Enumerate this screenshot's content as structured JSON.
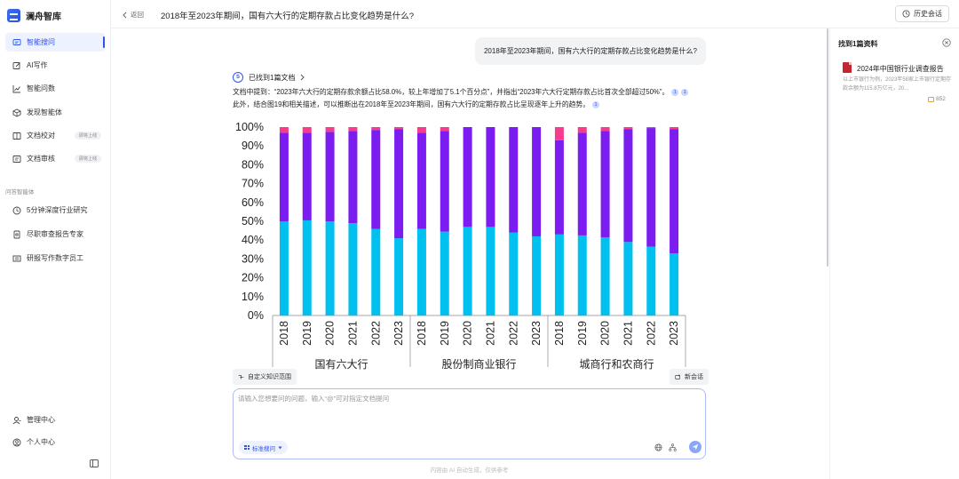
{
  "app": {
    "brand": "澜舟智库"
  },
  "sidebar": {
    "items": [
      {
        "label": "智能搜问",
        "icon": "chat-icon",
        "active": true,
        "badge": ""
      },
      {
        "label": "AI写作",
        "icon": "edit-icon",
        "active": false,
        "badge": ""
      },
      {
        "label": "智能问数",
        "icon": "chart-line-icon",
        "active": false,
        "badge": ""
      },
      {
        "label": "发现智能体",
        "icon": "cube-icon",
        "active": false,
        "badge": ""
      },
      {
        "label": "文档校对",
        "icon": "doc-check-icon",
        "active": false,
        "badge": "即将上线"
      },
      {
        "label": "文档审核",
        "icon": "doc-review-icon",
        "active": false,
        "badge": "即将上线"
      }
    ],
    "section_label": "问答智能体",
    "agents": [
      {
        "label": "5分钟深度行业研究",
        "icon": "clock-icon"
      },
      {
        "label": "尽职审查报告专家",
        "icon": "report-icon"
      },
      {
        "label": "研报写作数字员工",
        "icon": "book-icon"
      }
    ],
    "bottom": [
      {
        "label": "管理中心",
        "icon": "admin-icon"
      },
      {
        "label": "个人中心",
        "icon": "user-icon"
      }
    ]
  },
  "topbar": {
    "back_label": "返回",
    "title": "2018年至2023年期间，国有六大行的定期存款占比变化趋势是什么?",
    "history_label": "历史会话"
  },
  "chat": {
    "user_question": "2018年至2023年期间，国有六大行的定期存款占比变化趋势是什么?",
    "found_label": "已找到1篇文档",
    "answer_line1": "文档中提到：“2023年六大行的定期存款余额占比58.0%，较上年增加了5.1个百分点”，并指出“2023年六大行定期存款占比首次全部超过50%”。",
    "answer_line2": "此外，结合图19和相关描述，可以推断出在2018年至2023年期间，国有六大行的定期存款占比呈现逐年上升的趋势。",
    "cite_num": "1"
  },
  "chart_data": {
    "type": "bar",
    "stacked": true,
    "ylim": [
      0,
      100
    ],
    "yticks": [
      "0%",
      "10%",
      "20%",
      "30%",
      "40%",
      "50%",
      "60%",
      "70%",
      "80%",
      "90%",
      "100%"
    ],
    "years": [
      "2018",
      "2019",
      "2020",
      "2021",
      "2022",
      "2023"
    ],
    "groups": [
      {
        "name": "国有六大行",
        "cyan": [
          50,
          50.5,
          50,
          49,
          46,
          41
        ],
        "purple": [
          47,
          46.5,
          47.5,
          49,
          52.5,
          58
        ],
        "pink": [
          3,
          3,
          2.5,
          2,
          1.5,
          1
        ]
      },
      {
        "name": "股份制商业银行",
        "cyan": [
          46,
          44.5,
          47,
          47,
          44,
          42
        ],
        "purple": [
          51,
          53.5,
          53,
          53,
          56,
          58
        ],
        "pink": [
          3,
          2,
          0,
          0,
          0,
          0
        ]
      },
      {
        "name": "城商行和农商行",
        "cyan": [
          43,
          42.5,
          41.5,
          39,
          36.5,
          33
        ],
        "purple": [
          50,
          54.5,
          56.5,
          60,
          63,
          66
        ],
        "pink": [
          7,
          3,
          2,
          1,
          0.5,
          1
        ]
      }
    ],
    "colors": {
      "cyan": "#00c0f0",
      "purple": "#7b1cf0",
      "pink": "#f73b8d"
    }
  },
  "controls": {
    "kb_label": "自定义知识范围",
    "new_label": "新会话",
    "input_placeholder": "请输入您想要问的问题，输入“@”可对指定文档提问",
    "mode_label": "标准搜问",
    "disclaimer": "内容由 AI 自动生成，仅供参考"
  },
  "right_panel": {
    "title": "找到1篇资料",
    "doc_title": "2024年中国银行业调查报告",
    "doc_snippet": "以上市银行为例，2023年58家上市银行定期存款余额为115.8万亿元，20...",
    "doc_views": "852"
  }
}
